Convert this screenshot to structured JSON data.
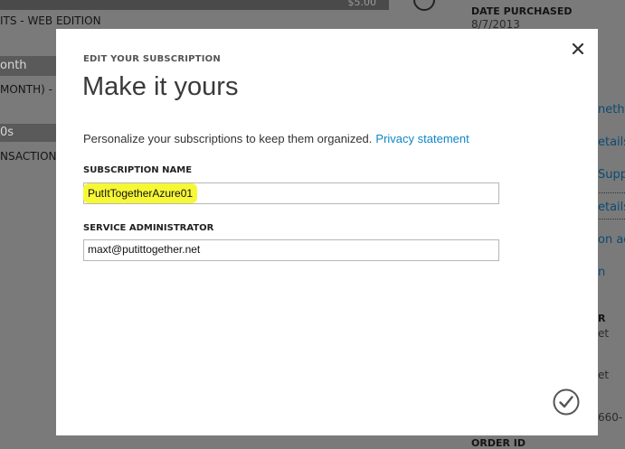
{
  "background": {
    "left_col": [
      {
        "text": "ITS - WEB EDITION"
      },
      {
        "text": "onth"
      },
      {
        "text": "MONTH) - C"
      },
      {
        "text": "0s"
      },
      {
        "text": "NSACTIONS"
      }
    ],
    "top_price": "$5.00",
    "right_col": {
      "date_purchased_label": "DATE PURCHASED",
      "date_purchased_value": "8/7/2013",
      "links": [
        "nethe",
        "etails",
        "Supp",
        "etails",
        "on ad",
        "n"
      ],
      "owner_label": "R",
      "val1": "et",
      "val2": "et",
      "id_frag": "660-",
      "order_id_label": "ORDER ID"
    }
  },
  "dialog": {
    "eyebrow": "EDIT YOUR SUBSCRIPTION",
    "title": "Make it yours",
    "description": "Personalize your subscriptions to keep them organized.",
    "privacy_link": "Privacy statement",
    "subscription_name_label": "SUBSCRIPTION NAME",
    "subscription_name_value": "PutItTogetherAzure01",
    "service_admin_label": "SERVICE ADMINISTRATOR",
    "service_admin_value": "maxt@putittogether.net"
  },
  "icons": {
    "close": "close-icon",
    "confirm": "checkmark-circle-icon"
  }
}
